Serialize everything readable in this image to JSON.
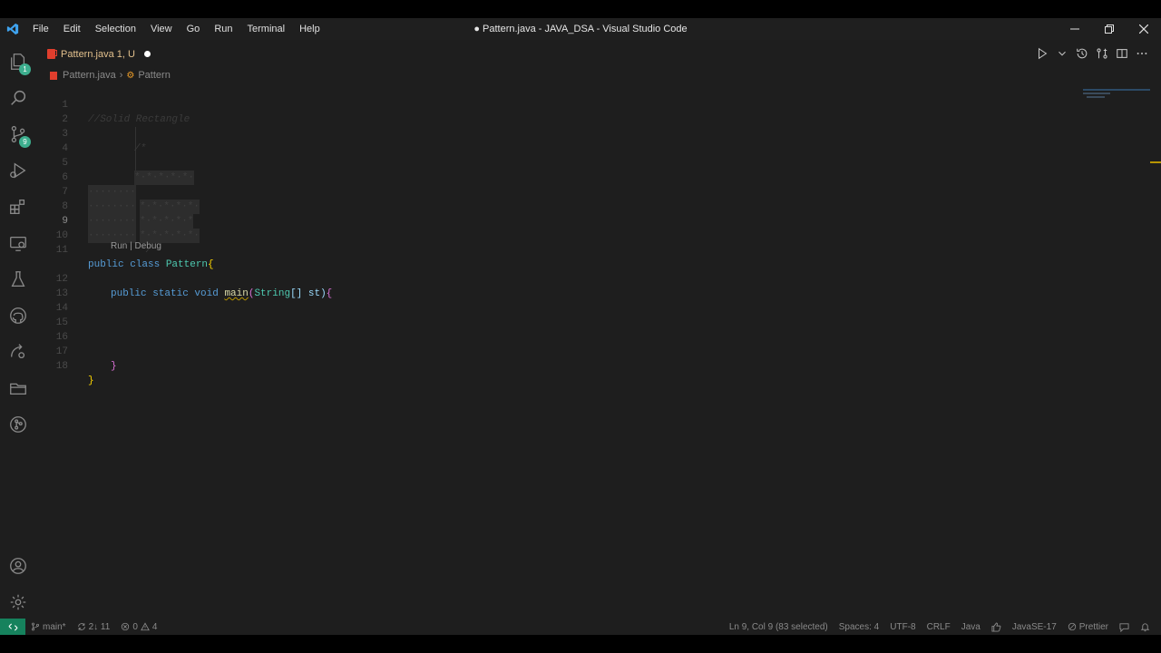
{
  "window": {
    "title": "● Pattern.java - JAVA_DSA - Visual Studio Code"
  },
  "menu": [
    "File",
    "Edit",
    "Selection",
    "View",
    "Go",
    "Run",
    "Terminal",
    "Help"
  ],
  "activity": {
    "explorer_badge": "1",
    "scm_badge": "9"
  },
  "tab": {
    "label": "Pattern.java 1, U",
    "modified": true
  },
  "breadcrumb": {
    "file": "Pattern.java",
    "symbol": "Pattern"
  },
  "editor": {
    "line_numbers": [
      "1",
      "2",
      "3",
      "4",
      "5",
      "6",
      "7",
      "8",
      "9",
      "10",
      "11",
      "12",
      "13",
      "14",
      "15",
      "16",
      "17",
      "18"
    ],
    "active_line": "9",
    "codelens": "Run | Debug",
    "lines": {
      "l1": "//Solid Rectangle",
      "l3": "/*",
      "l5": "*·*·*·*·*·",
      "l6a": "········",
      "l6b": "*·*·*·*·*·",
      "l7a": "········",
      "l7b": "*·*·*·*·*",
      "l8a": "········",
      "l8b": "*·*·*·*·*·",
      "l9": "········",
      "l10": "*/",
      "l11_kw": "public class",
      "l11_cls": "Pattern",
      "l11_brace": "{",
      "l12_kw": "public static void",
      "l12_fn": "main",
      "l12_paren": "(",
      "l12_type": "String",
      "l12_rest": "[] st)",
      "l12_brace": "{",
      "l17": "}",
      "l18": "}"
    }
  },
  "status": {
    "branch": "main*",
    "sync": "2↓ 11",
    "errors": "0",
    "warnings": "4",
    "position": "Ln 9, Col 9 (83 selected)",
    "spaces": "Spaces: 4",
    "encoding": "UTF-8",
    "eol": "CRLF",
    "language": "Java",
    "jdk": "JavaSE-17",
    "formatter": "Prettier"
  },
  "colors": {
    "accent_remote": "#16825d",
    "badge": "#3dae8e",
    "java_icon": "#e03e2d"
  }
}
